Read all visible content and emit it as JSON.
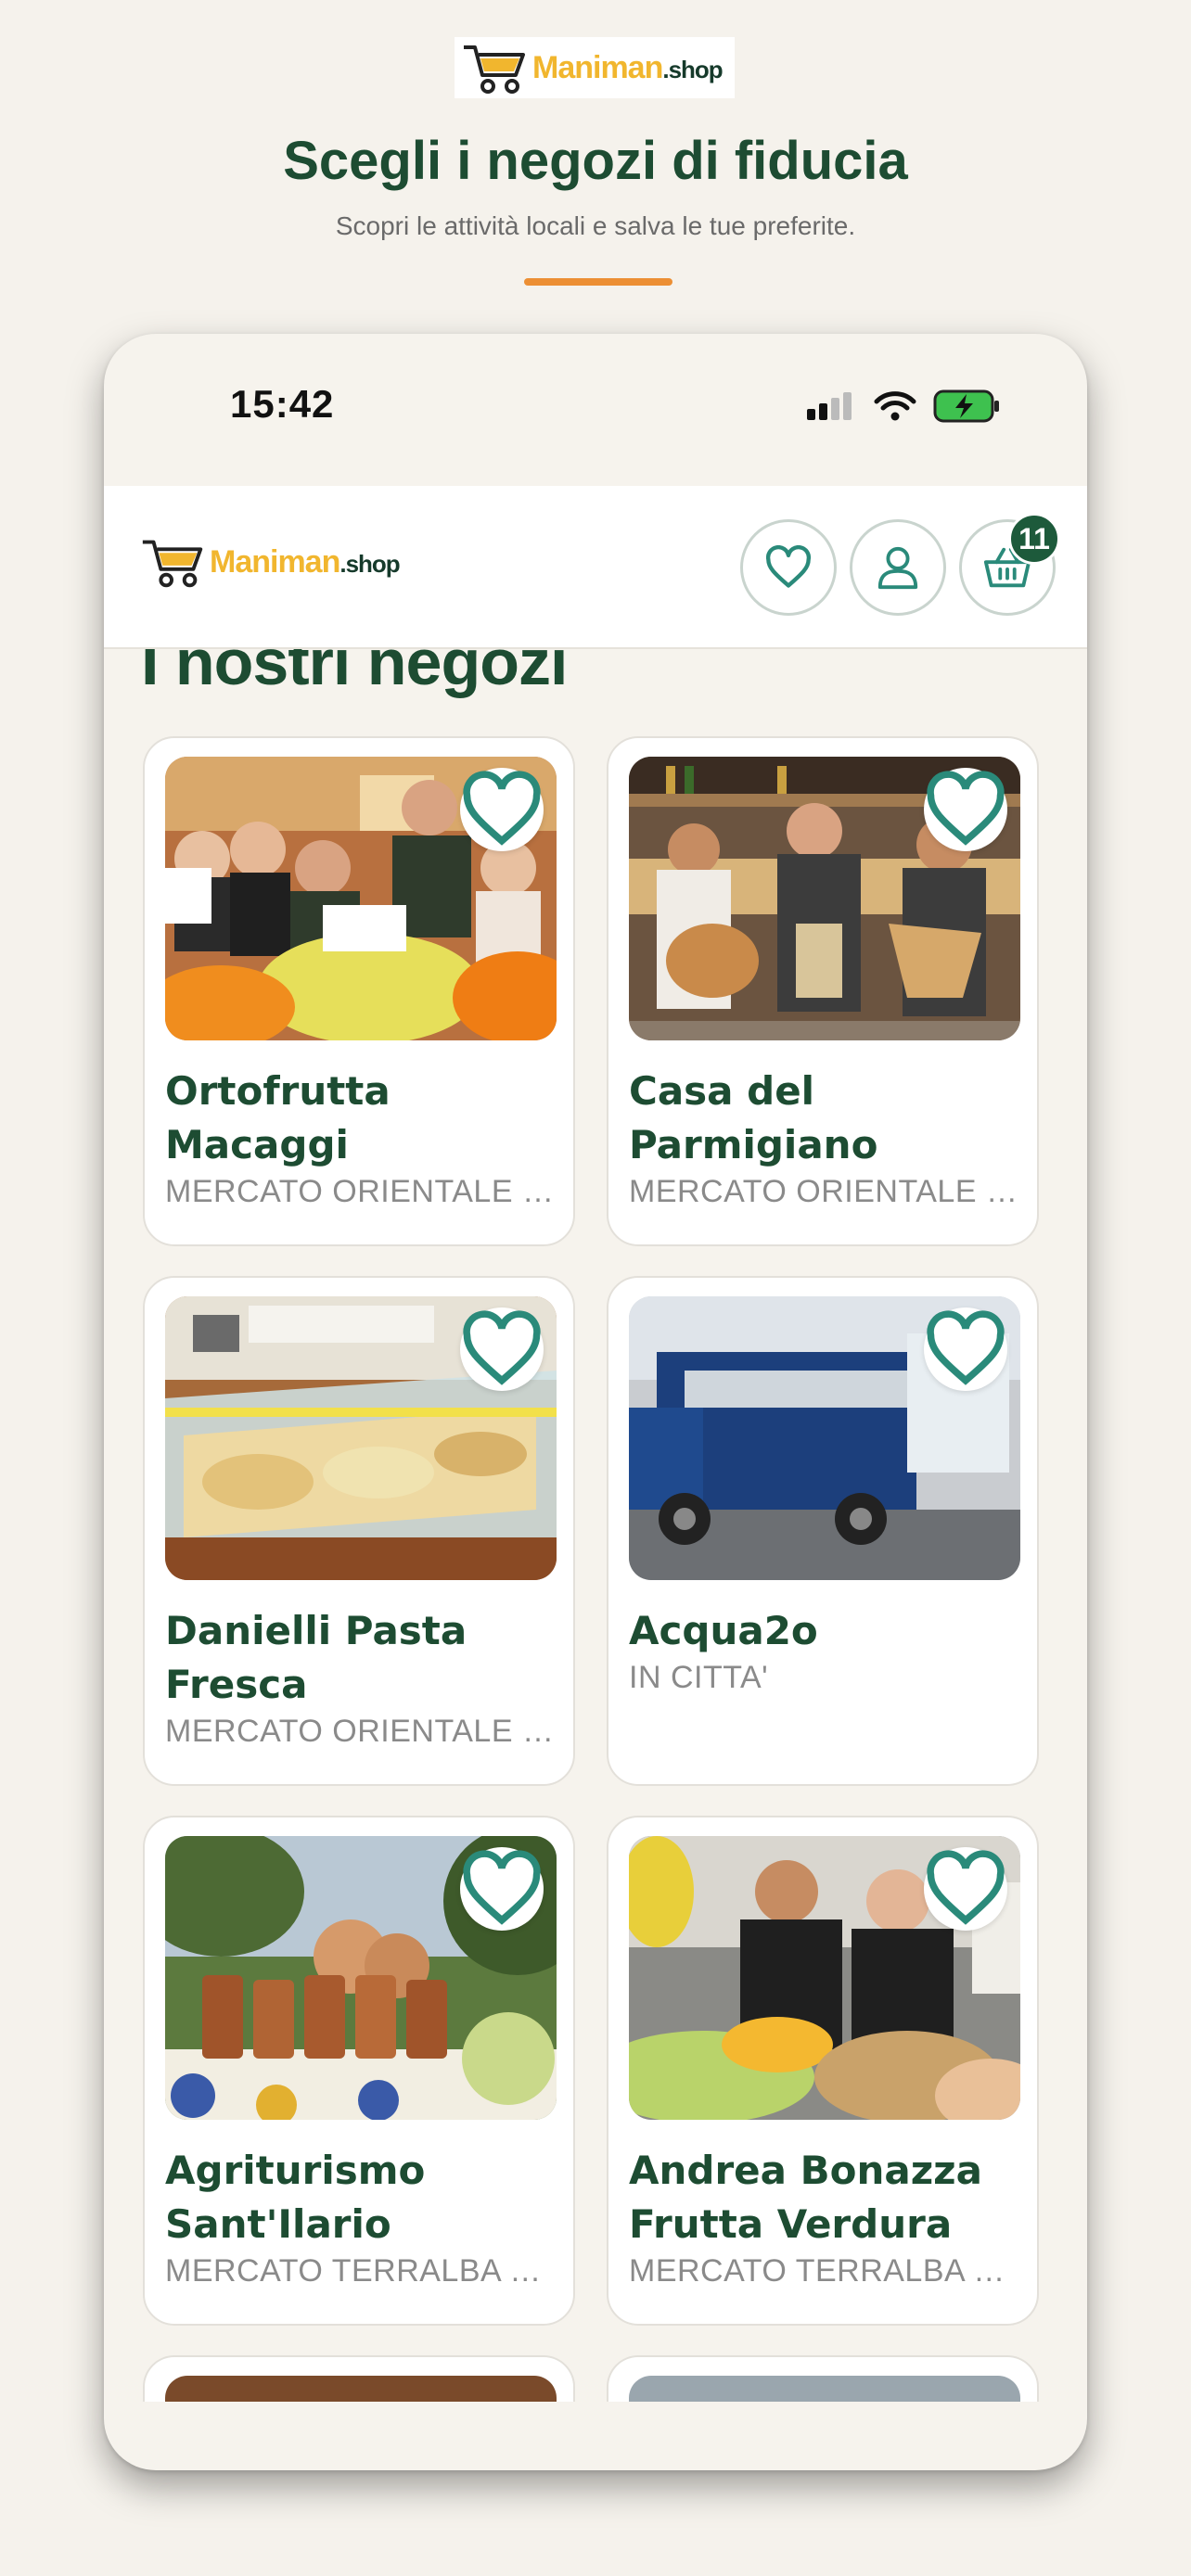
{
  "header": {
    "logo_text": "Maniman",
    "logo_suffix": ".shop",
    "title": "Scegli i negozi di fiducia",
    "subtitle": "Scopri le attività locali e salva le tue preferite."
  },
  "device": {
    "time": "15:42"
  },
  "appbar": {
    "logo_text": "Maniman",
    "logo_suffix": ".shop",
    "cart_count": "11"
  },
  "main": {
    "section_title": "I nostri negozi",
    "shops": [
      {
        "name": "Ortofrutta Macaggi",
        "location": "MERCATO ORIENTALE GENOVA"
      },
      {
        "name": "Casa del Parmigiano",
        "location": "MERCATO ORIENTALE GENOVA"
      },
      {
        "name": "Danielli Pasta Fresca",
        "location": "MERCATO ORIENTALE GENOVA"
      },
      {
        "name": "Acqua2o",
        "location": "IN CITTA'"
      },
      {
        "name": "Agriturismo Sant'Ilario",
        "location": "MERCATO TERRALBA e altri"
      },
      {
        "name": "Andrea Bonazza Frutta Verdura",
        "location": "MERCATO TERRALBA e altri"
      }
    ]
  },
  "colors": {
    "brand_green": "#1d4c32",
    "accent_orange": "#ec8f34",
    "logo_yellow": "#f1b62e",
    "icon_teal": "#2a8a7a",
    "badge_green": "#1d5a3b"
  }
}
